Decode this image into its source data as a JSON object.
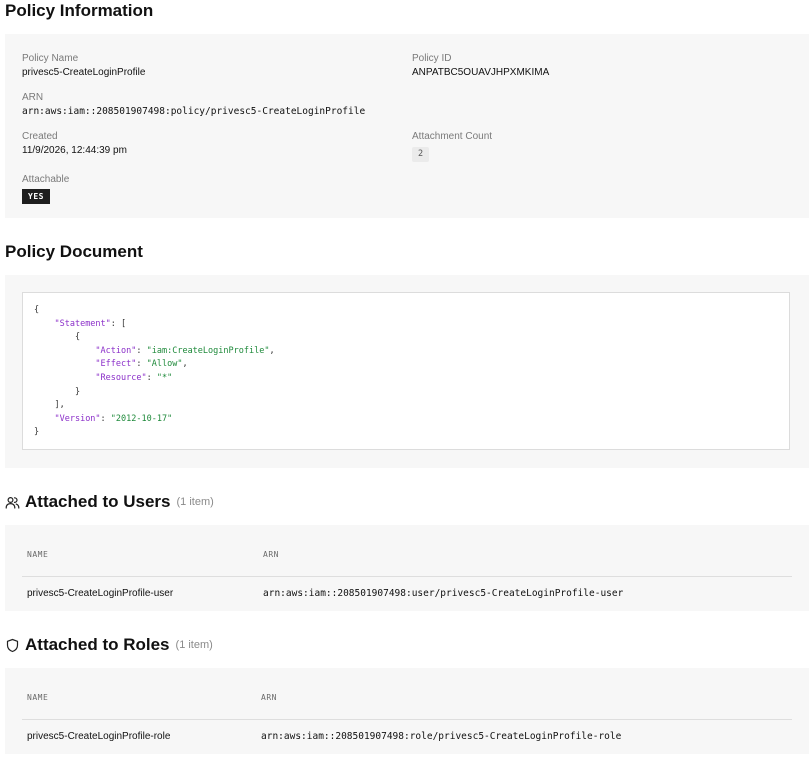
{
  "policy_info": {
    "title": "Policy Information",
    "policy_name": {
      "label": "Policy Name",
      "value": "privesc5-CreateLoginProfile"
    },
    "policy_id": {
      "label": "Policy ID",
      "value": "ANPATBC5OUAVJHPXMKIMA"
    },
    "arn": {
      "label": "ARN",
      "value": "arn:aws:iam::208501907498:policy/privesc5-CreateLoginProfile"
    },
    "created": {
      "label": "Created",
      "value": "11/9/2026, 12:44:39 pm"
    },
    "attachment_count": {
      "label": "Attachment Count",
      "value": "2"
    },
    "attachable": {
      "label": "Attachable",
      "value": "YES"
    }
  },
  "policy_document": {
    "title": "Policy Document",
    "brace_open": "{",
    "statement_key": "\"Statement\"",
    "bracket_open": "[",
    "obj_open": "{",
    "action_key": "\"Action\"",
    "action_value": "\"iam:CreateLoginProfile\"",
    "effect_key": "\"Effect\"",
    "effect_value": "\"Allow\"",
    "resource_key": "\"Resource\"",
    "resource_value": "\"*\"",
    "obj_close": "}",
    "bracket_close": "],",
    "version_key": "\"Version\"",
    "version_value": "\"2012-10-17\"",
    "brace_close": "}"
  },
  "attached_users": {
    "title": "Attached to Users",
    "count": "(1 item)",
    "icon": "users-icon",
    "columns": [
      "NAME",
      "ARN"
    ],
    "rows": [
      {
        "name": "privesc5-CreateLoginProfile-user",
        "arn": "arn:aws:iam::208501907498:user/privesc5-CreateLoginProfile-user"
      }
    ]
  },
  "attached_roles": {
    "title": "Attached to Roles",
    "count": "(1 item)",
    "icon": "shield-icon",
    "columns": [
      "NAME",
      "ARN"
    ],
    "rows": [
      {
        "name": "privesc5-CreateLoginProfile-role",
        "arn": "arn:aws:iam::208501907498:role/privesc5-CreateLoginProfile-role"
      }
    ]
  },
  "colors": {
    "panel_bg": "#f7f7f7",
    "json_key": "#8b2fc9",
    "json_string": "#1f8a3b",
    "badge_bg": "#1e1e1e"
  }
}
